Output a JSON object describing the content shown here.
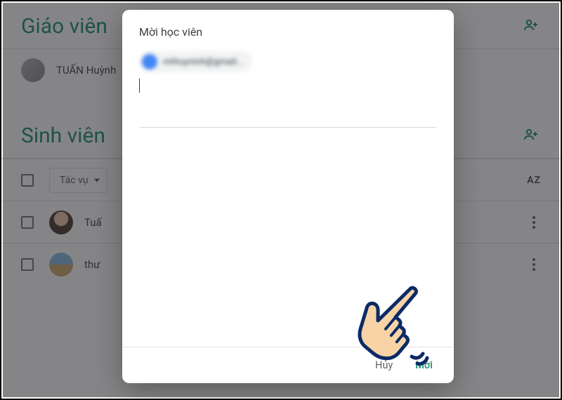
{
  "teachers_section": {
    "title": "Giáo viên",
    "add_tooltip": "Mời giáo viên",
    "list": [
      {
        "name": "TUẤN Huỳnh"
      }
    ]
  },
  "students_section": {
    "title": "Sinh viên",
    "add_tooltip": "Mời học viên",
    "bulk_actions_label": "Tác vụ",
    "sort_label": "AZ",
    "list": [
      {
        "name": "Tuấ"
      },
      {
        "name": "thư"
      }
    ]
  },
  "dialog": {
    "title": "Mời học viên",
    "chip_text": "mthuyninh@gmail...",
    "input_value": "",
    "input_placeholder": "",
    "cancel_label": "Hủy",
    "confirm_label": "Mời"
  },
  "colors": {
    "accent": "#1e8e75"
  }
}
